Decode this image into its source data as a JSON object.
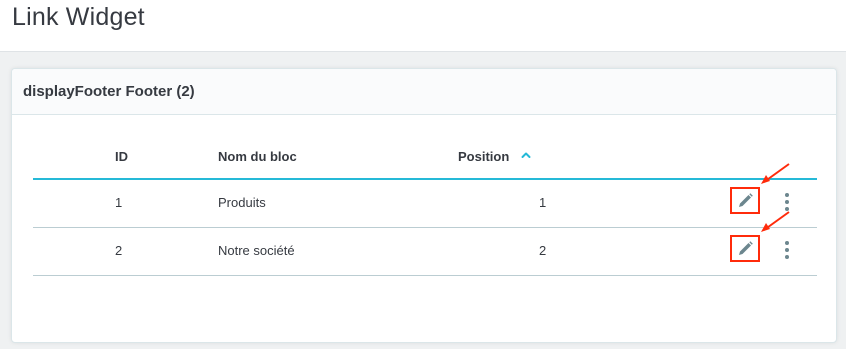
{
  "page": {
    "title": "Link Widget"
  },
  "card": {
    "title": "displayFooter Footer (2)"
  },
  "table": {
    "columns": {
      "id": "ID",
      "name": "Nom du bloc",
      "position": "Position"
    },
    "sort": {
      "column": "position",
      "direction": "ascending",
      "icon": "chevron-up-icon",
      "color": "#25b9d7"
    },
    "rows": [
      {
        "id": "1",
        "name": "Produits",
        "position": "1"
      },
      {
        "id": "2",
        "name": "Notre société",
        "position": "2"
      }
    ],
    "row_actions": {
      "edit_icon": "pencil-icon",
      "more_icon": "more-vertical-icon"
    }
  },
  "annotation": {
    "color": "#ff2b0b"
  }
}
